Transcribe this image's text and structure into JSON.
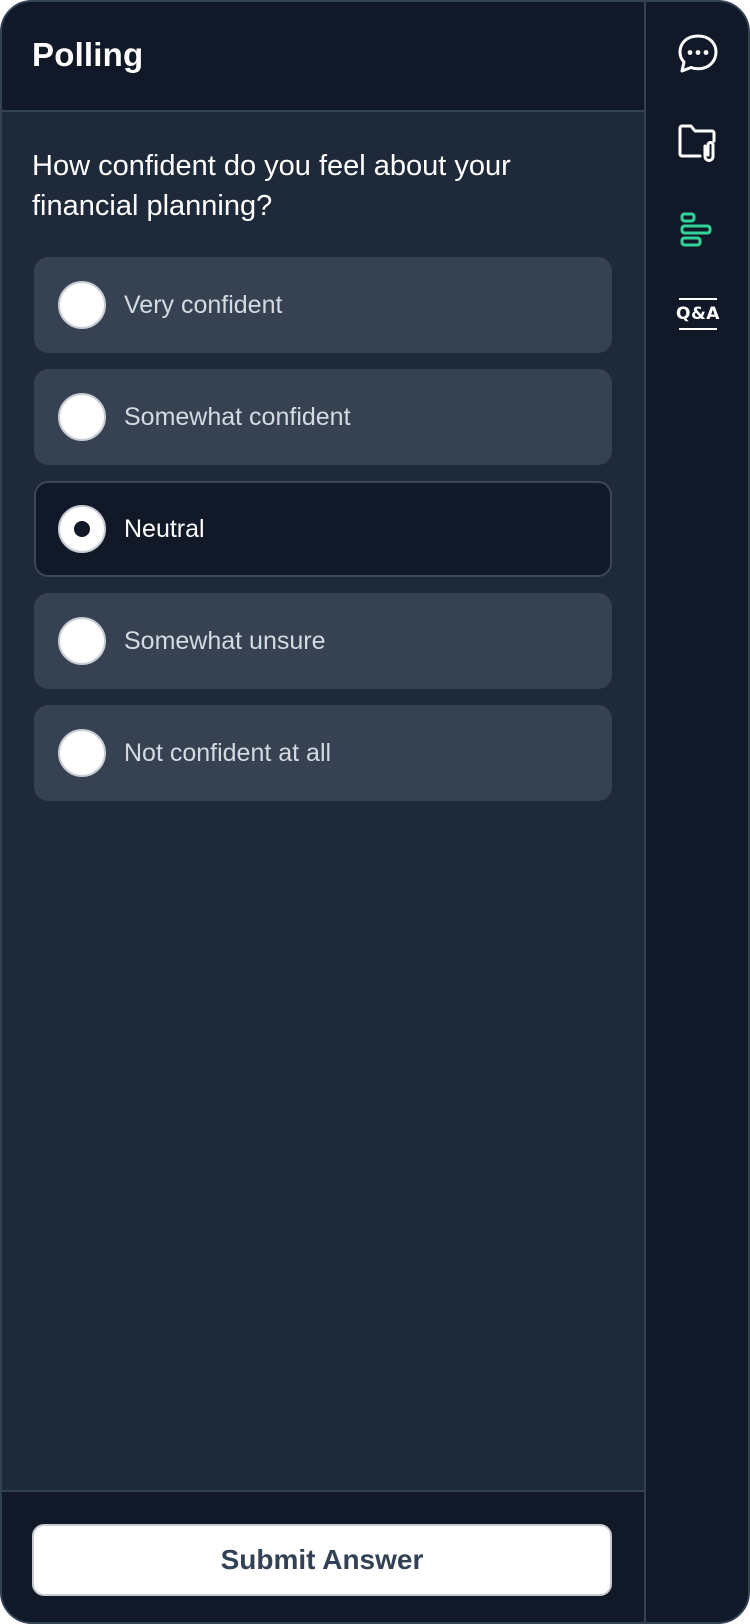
{
  "panel": {
    "title": "Polling"
  },
  "poll": {
    "question": "How confident do you feel about your financial planning?",
    "selected_index": 2,
    "options": [
      {
        "label": "Very confident"
      },
      {
        "label": "Somewhat confident"
      },
      {
        "label": "Neutral"
      },
      {
        "label": "Somewhat unsure"
      },
      {
        "label": "Not confident at all"
      }
    ]
  },
  "footer": {
    "submit_label": "Submit Answer"
  },
  "sidebar": {
    "items": [
      {
        "icon": "chat-icon",
        "active": false
      },
      {
        "icon": "folder-attachment-icon",
        "active": false
      },
      {
        "icon": "poll-icon",
        "active": true
      },
      {
        "icon": "qa-icon",
        "label": "Q&A",
        "active": false
      }
    ]
  },
  "colors": {
    "background": "#1e2939",
    "header": "#111827",
    "option": "#364152",
    "accent": "#34d399",
    "submit_text": "#334155"
  }
}
